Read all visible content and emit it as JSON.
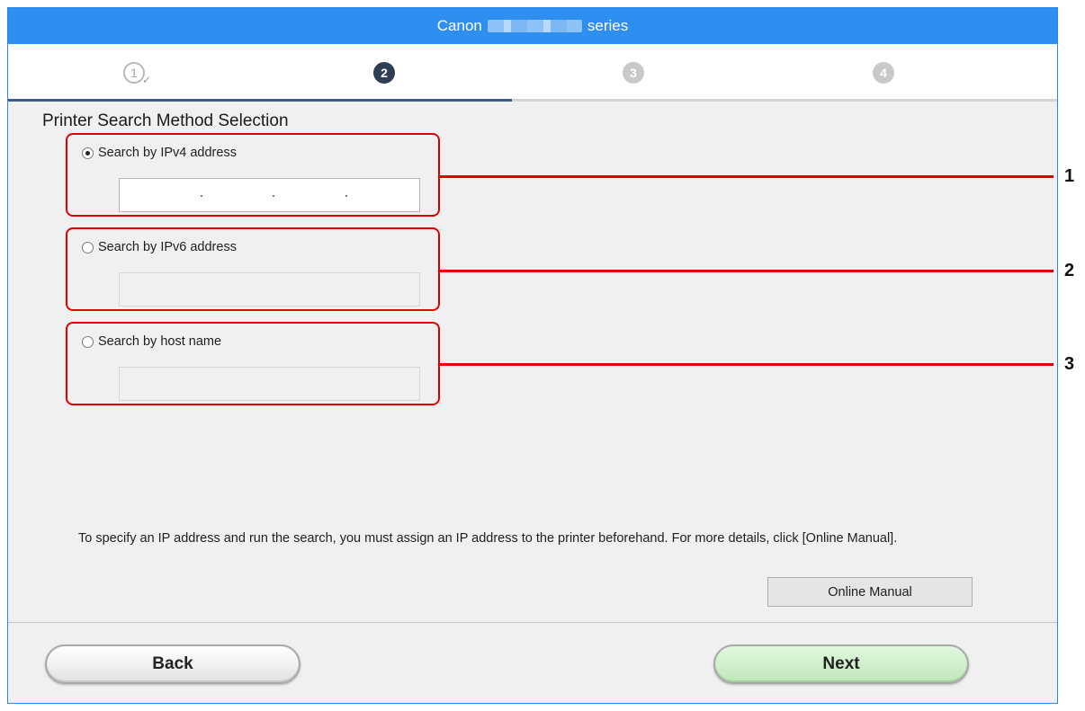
{
  "window": {
    "title_prefix": "Canon",
    "title_suffix": "series"
  },
  "steps": [
    {
      "number": "1",
      "state": "done"
    },
    {
      "number": "2",
      "state": "current"
    },
    {
      "number": "3",
      "state": "future"
    },
    {
      "number": "4",
      "state": "future"
    }
  ],
  "page": {
    "heading": "Printer Search Method Selection"
  },
  "options": [
    {
      "label": "Search by IPv4 address",
      "selected": true,
      "field_value": "",
      "field_enabled": true,
      "callout": "1"
    },
    {
      "label": "Search by IPv6 address",
      "selected": false,
      "field_value": "",
      "field_enabled": false,
      "callout": "2"
    },
    {
      "label": "Search by host name",
      "selected": false,
      "field_value": "",
      "field_enabled": false,
      "callout": "3"
    }
  ],
  "note": "To specify an IP address and run the search, you must assign an IP address to the printer beforehand. For more details, click [Online Manual].",
  "buttons": {
    "online_manual": "Online Manual",
    "back": "Back",
    "next": "Next"
  },
  "colors": {
    "titlebar": "#2f8ff0",
    "callout_red": "#e00000",
    "next_green": "#bfe8b9",
    "step_active": "#2d3e55"
  }
}
